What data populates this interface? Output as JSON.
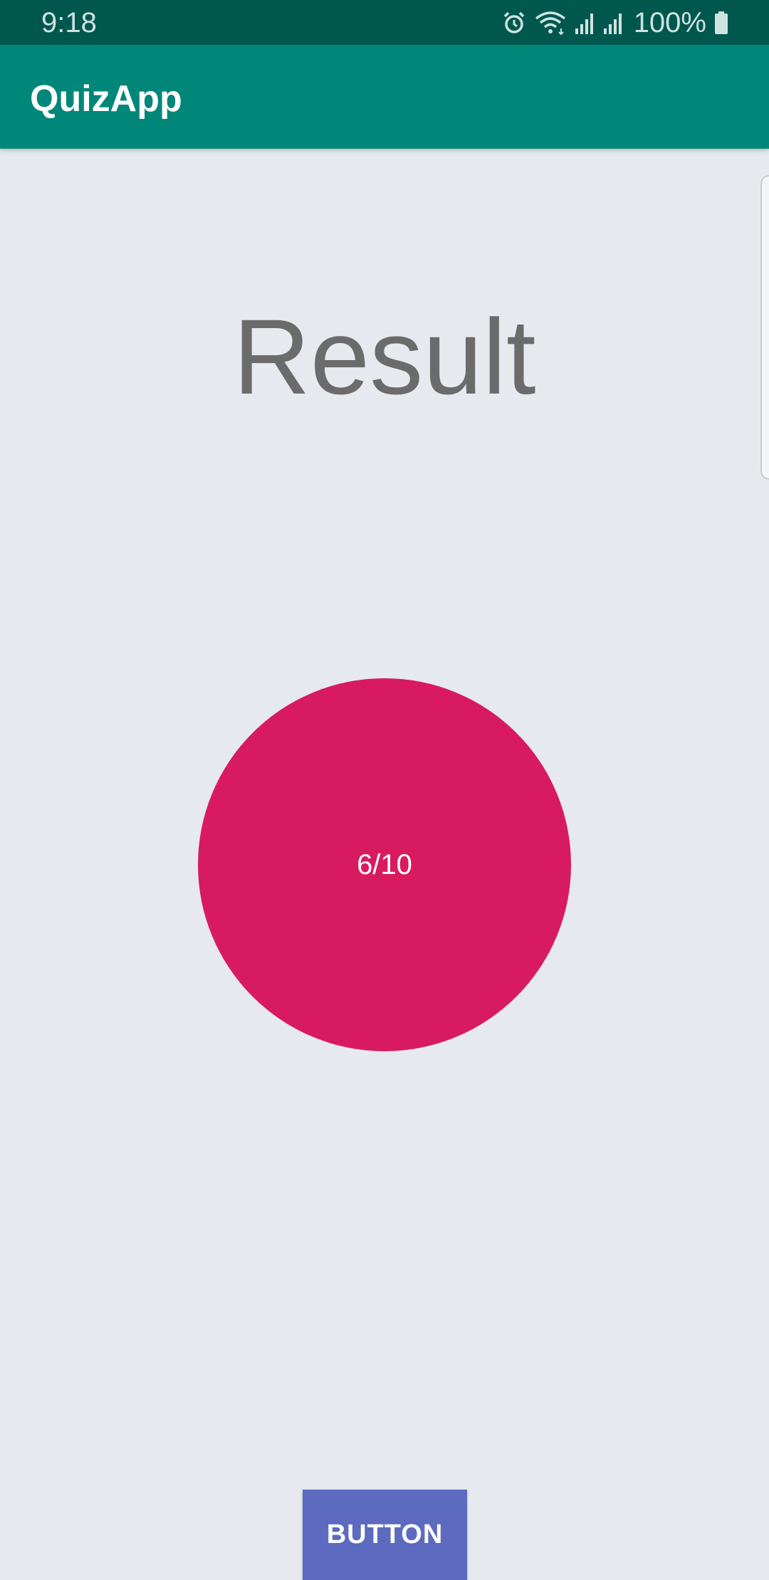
{
  "status_bar": {
    "time": "9:18",
    "battery_percent": "100%",
    "icons": [
      "alarm-icon",
      "wifi-icon",
      "signal-icon",
      "signal-icon",
      "battery-icon"
    ]
  },
  "app_bar": {
    "title": "QuizApp"
  },
  "main": {
    "heading": "Result",
    "score": "6/10",
    "button_label": "BUTTON"
  },
  "colors": {
    "status_bar_bg": "#00574E",
    "app_bar_bg": "#00877A",
    "background": "#E6E9ED",
    "score_circle": "#D81B60",
    "button_bg": "#5C6BC0",
    "heading_text": "#6B6B6B"
  }
}
